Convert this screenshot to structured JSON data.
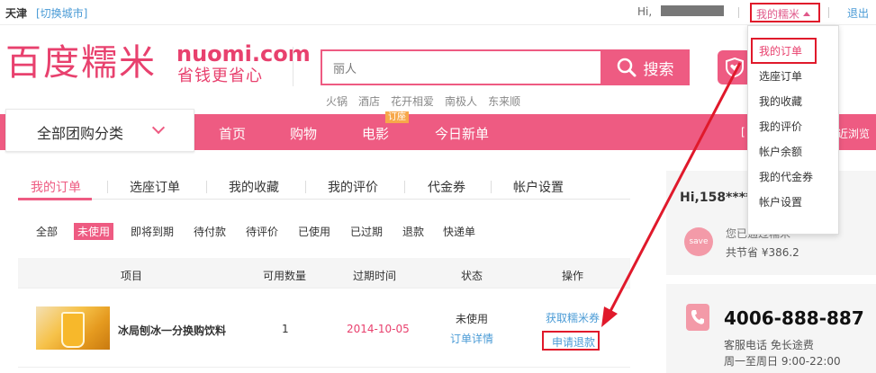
{
  "topbar": {
    "city": "天津",
    "switch_city": "[切换城市]",
    "greeting": "Hi,",
    "my_nuomi": "我的糯米",
    "logout": "退出"
  },
  "logo": {
    "cn": "百度糯米",
    "en": "nuomi.com",
    "slogan": "省钱更省心"
  },
  "search": {
    "value": "丽人",
    "button": "搜索",
    "hotwords": [
      "火锅",
      "酒店",
      "花开相爱",
      "南极人",
      "东来顺"
    ]
  },
  "nav": {
    "category": "全部团购分类",
    "items": [
      "首页",
      "购物",
      "电影",
      "今日新单"
    ],
    "badge": "订座",
    "recent_left": "[",
    "recent": "近浏览"
  },
  "tabs": [
    "我的订单",
    "选座订单",
    "我的收藏",
    "我的评价",
    "代金券",
    "帐户设置"
  ],
  "filters": [
    "全部",
    "未使用",
    "即将到期",
    "待付款",
    "待评价",
    "已使用",
    "已过期",
    "退款",
    "快递单"
  ],
  "table": {
    "headers": [
      "项目",
      "可用数量",
      "过期时间",
      "状态",
      "操作"
    ],
    "row": {
      "title": "冰局刨冰一分换购饮料",
      "qty": "1",
      "expiry": "2014-10-05",
      "status": "未使用",
      "detail": "订单详情",
      "action_get": "获取糯米券",
      "action_refund": "申请退款"
    }
  },
  "account_card": {
    "greeting": "Hi,158****",
    "save_label": "save",
    "saved_line1": "您已通过糯米",
    "saved_line2": "共节省 ¥386.2"
  },
  "service_card": {
    "phone": "4006-888-887",
    "desc": "客服电话 免长途费",
    "hours": "周一至周日 9:00-22:00"
  },
  "dropdown": {
    "items": [
      "我的订单",
      "选座订单",
      "我的收藏",
      "我的评价",
      "帐户余额",
      "我的代金券",
      "帐户设置"
    ]
  },
  "colors": {
    "brand": "#ee5b82",
    "highlight": "#e0192b",
    "link": "#4a9bd6"
  }
}
